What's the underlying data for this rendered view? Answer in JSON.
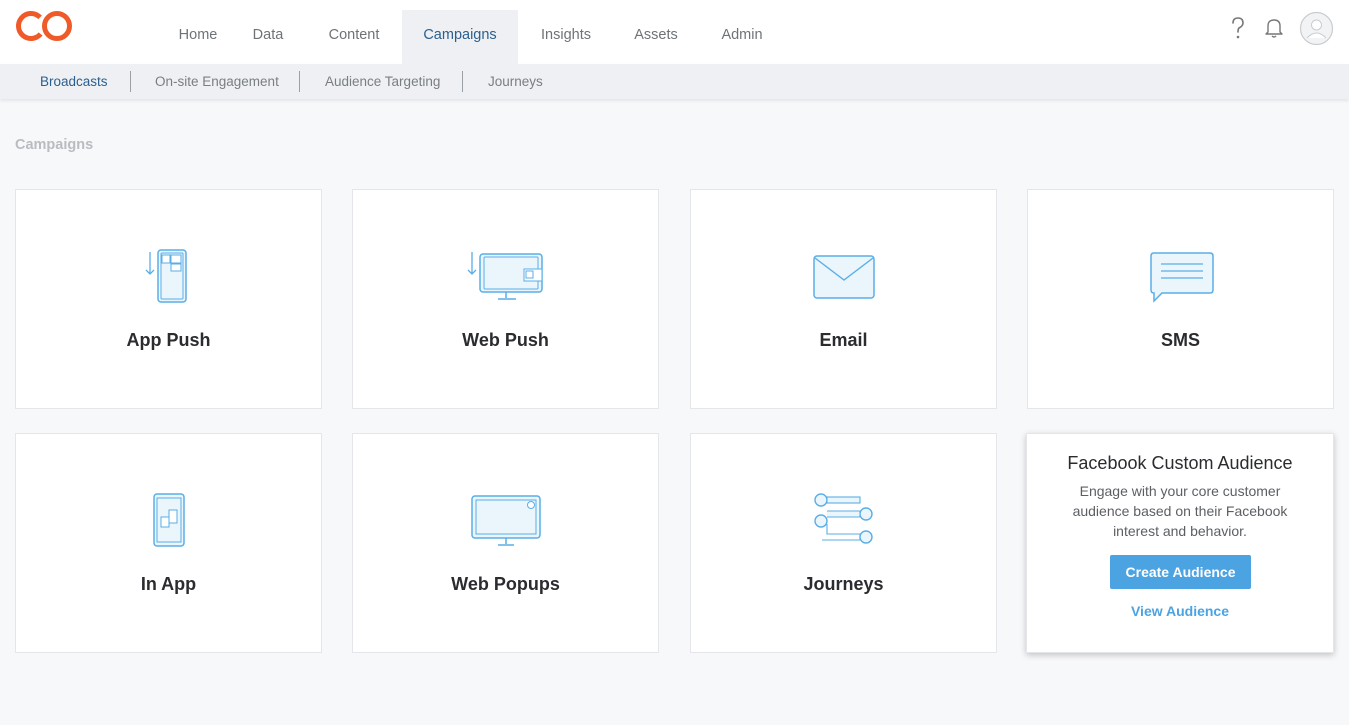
{
  "colors": {
    "brand": "#f05a28",
    "accent": "#4ba3e2",
    "active_nav": "#2c5f8f",
    "icon_stroke": "#5aaee6",
    "icon_fill": "#eaf5fc"
  },
  "topnav": {
    "items": [
      {
        "label": "Home"
      },
      {
        "label": "Data"
      },
      {
        "label": "Content"
      },
      {
        "label": "Campaigns",
        "active": true
      },
      {
        "label": "Insights"
      },
      {
        "label": "Assets"
      },
      {
        "label": "Admin"
      }
    ],
    "icons": [
      "help-icon",
      "bell-icon",
      "avatar"
    ]
  },
  "subnav": {
    "items": [
      {
        "label": "Broadcasts",
        "active": true
      },
      {
        "label": "On-site Engagement"
      },
      {
        "label": "Audience Targeting"
      },
      {
        "label": "Journeys"
      }
    ]
  },
  "page": {
    "title": "Campaigns"
  },
  "cards": [
    {
      "label": "App Push",
      "icon": "app-push-icon"
    },
    {
      "label": "Web Push",
      "icon": "web-push-icon"
    },
    {
      "label": "Email",
      "icon": "email-icon"
    },
    {
      "label": "SMS",
      "icon": "sms-icon"
    },
    {
      "label": "In App",
      "icon": "in-app-icon"
    },
    {
      "label": "Web Popups",
      "icon": "web-popup-icon"
    },
    {
      "label": "Journeys",
      "icon": "journeys-icon"
    }
  ],
  "facebook": {
    "title": "Facebook Custom Audience",
    "description": "Engage with your core customer audience based on their Facebook interest and behavior.",
    "create_label": "Create Audience",
    "view_label": "View Audience"
  }
}
